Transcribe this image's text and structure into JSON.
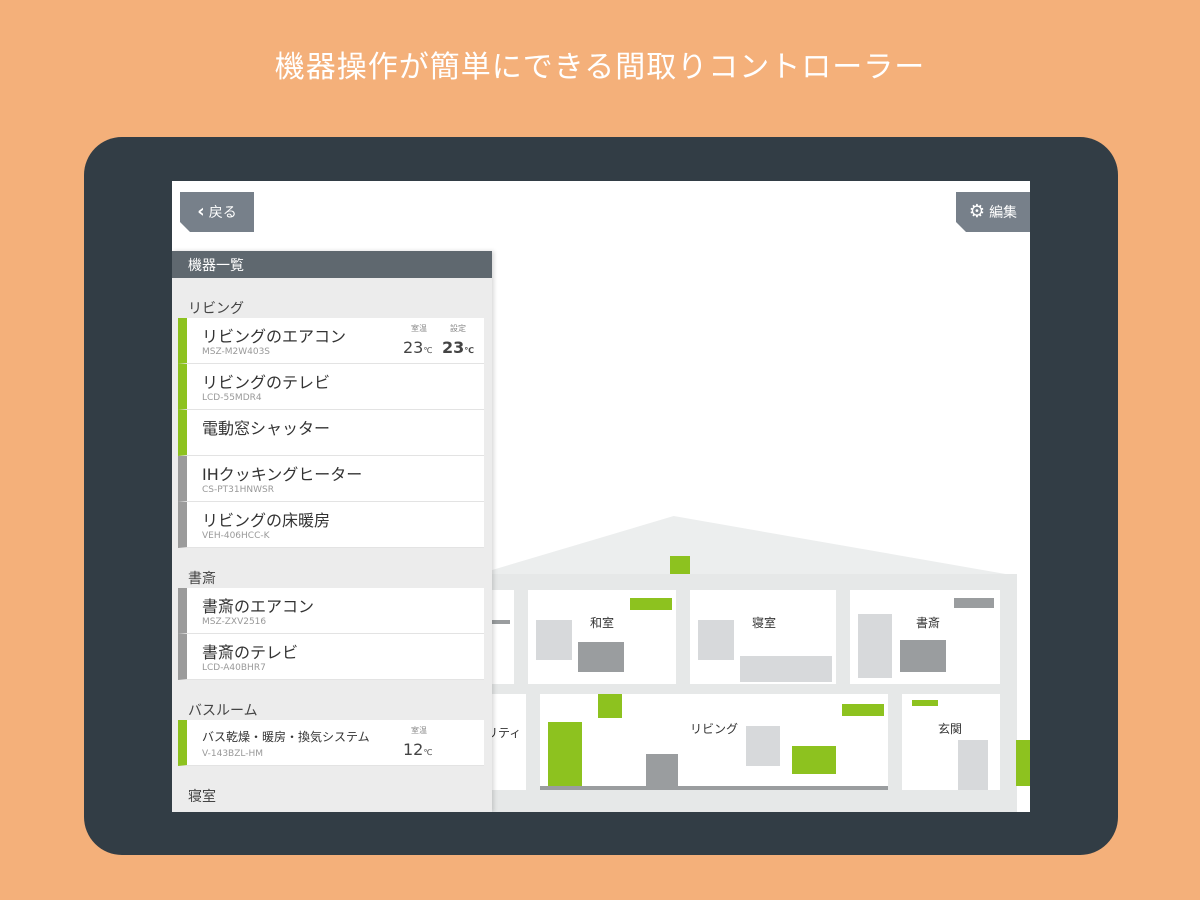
{
  "headline": "機器操作が簡単にできる間取りコントローラー",
  "top_bar": {
    "back_label": "戻る",
    "edit_label": "編集"
  },
  "panel": {
    "title": "機器一覧",
    "groups": [
      {
        "name": "リビング",
        "items": [
          {
            "name": "リビングのエアコン",
            "model": "MSZ-M2W403S",
            "room_label": "室温",
            "room_temp": "23",
            "set_label": "設定",
            "set_temp": "23",
            "unit": "℃",
            "on": true
          },
          {
            "name": "リビングのテレビ",
            "model": "LCD-55MDR4",
            "on": true
          },
          {
            "name": "電動窓シャッター",
            "model": "",
            "on": true
          },
          {
            "name": "IHクッキングヒーター",
            "model": "CS-PT31HNWSR",
            "on": false
          },
          {
            "name": "リビングの床暖房",
            "model": "VEH-406HCC-K",
            "on": false
          }
        ]
      },
      {
        "name": "書斎",
        "items": [
          {
            "name": "書斎のエアコン",
            "model": "MSZ-ZXV2516",
            "on": false
          },
          {
            "name": "書斎のテレビ",
            "model": "LCD-A40BHR7",
            "on": false
          }
        ]
      },
      {
        "name": "バスルーム",
        "items": [
          {
            "name": "バス乾燥・暖房・換気システム",
            "model": "V-143BZL-HM",
            "room_label": "室温",
            "room_temp": "12",
            "unit": "℃",
            "on": true
          }
        ]
      },
      {
        "name": "寝室",
        "items": []
      }
    ]
  },
  "floorplan": {
    "rooms": [
      "和室",
      "寝室",
      "書斎",
      "リビング",
      "玄関",
      "ユーティリティー"
    ],
    "colors": {
      "on": "#8dc21f",
      "off": "#9a9d9f"
    }
  }
}
